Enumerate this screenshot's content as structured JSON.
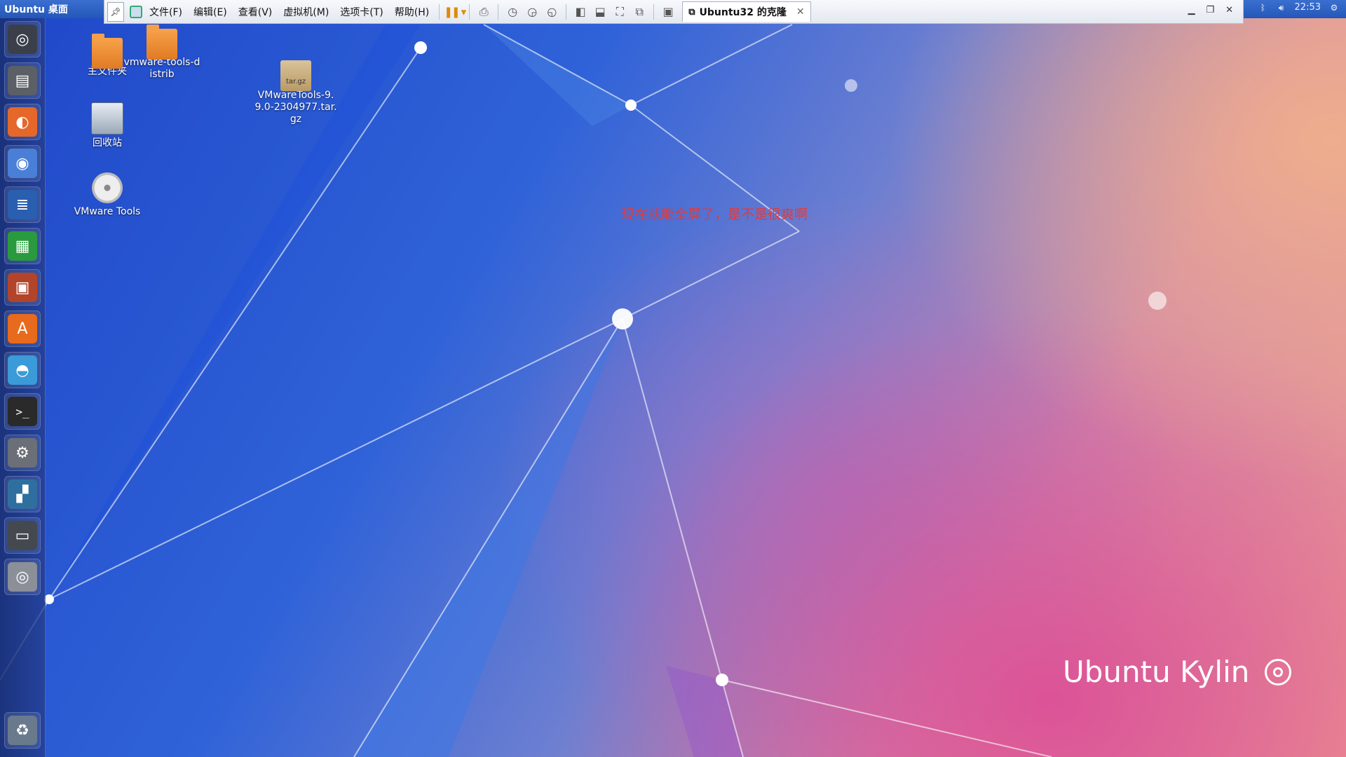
{
  "top_panel": {
    "title": "Ubuntu 桌面",
    "time": "22:53"
  },
  "vmware": {
    "menus": [
      "文件(F)",
      "编辑(E)",
      "查看(V)",
      "虚拟机(M)",
      "选项卡(T)",
      "帮助(H)"
    ],
    "tab_label": "Ubuntu32 的克隆",
    "tab_close": "✕"
  },
  "desktop_icons": [
    {
      "label": "主文件夹",
      "icon": "home-folder-icon"
    },
    {
      "label": "vmware-tools-distrib",
      "icon": "folder-icon"
    },
    {
      "label": "VMwareTools-9.9.0-2304977.tar.gz",
      "icon": "archive-icon",
      "badge": "tar.gz"
    },
    {
      "label": "回收站",
      "icon": "trash-icon"
    },
    {
      "label": "VMware Tools",
      "icon": "disc-icon"
    }
  ],
  "launcher": [
    {
      "name": "dash-home",
      "color": "#3a3f4a",
      "glyph": "◎"
    },
    {
      "name": "files",
      "color": "#5b5f66",
      "glyph": "▤"
    },
    {
      "name": "firefox",
      "color": "#e6672a",
      "glyph": "◐"
    },
    {
      "name": "chromium",
      "color": "#4a7fd8",
      "glyph": "◉"
    },
    {
      "name": "writer",
      "color": "#2a5fb0",
      "glyph": "≣"
    },
    {
      "name": "calc",
      "color": "#2a9a3e",
      "glyph": "▦"
    },
    {
      "name": "impress",
      "color": "#b2442a",
      "glyph": "▣"
    },
    {
      "name": "software-center",
      "color": "#e86a1c",
      "glyph": "A"
    },
    {
      "name": "backup",
      "color": "#3b9ad8",
      "glyph": "◓"
    },
    {
      "name": "terminal",
      "color": "#2a2a2a",
      "glyph": ">_"
    },
    {
      "name": "system-settings",
      "color": "#6a6f78",
      "glyph": "⚙"
    },
    {
      "name": "workspace-switcher",
      "color": "#2f6fa0",
      "glyph": "▞"
    },
    {
      "name": "floppy",
      "color": "#44484f",
      "glyph": "▭"
    },
    {
      "name": "dvd",
      "color": "#8a8f98",
      "glyph": "◎"
    },
    {
      "name": "trash",
      "color": "#6a7a8d",
      "glyph": "♻"
    }
  ],
  "annotation": "现在就能全屏了，是不是很爽啊",
  "brand": "Ubuntu Kylin"
}
